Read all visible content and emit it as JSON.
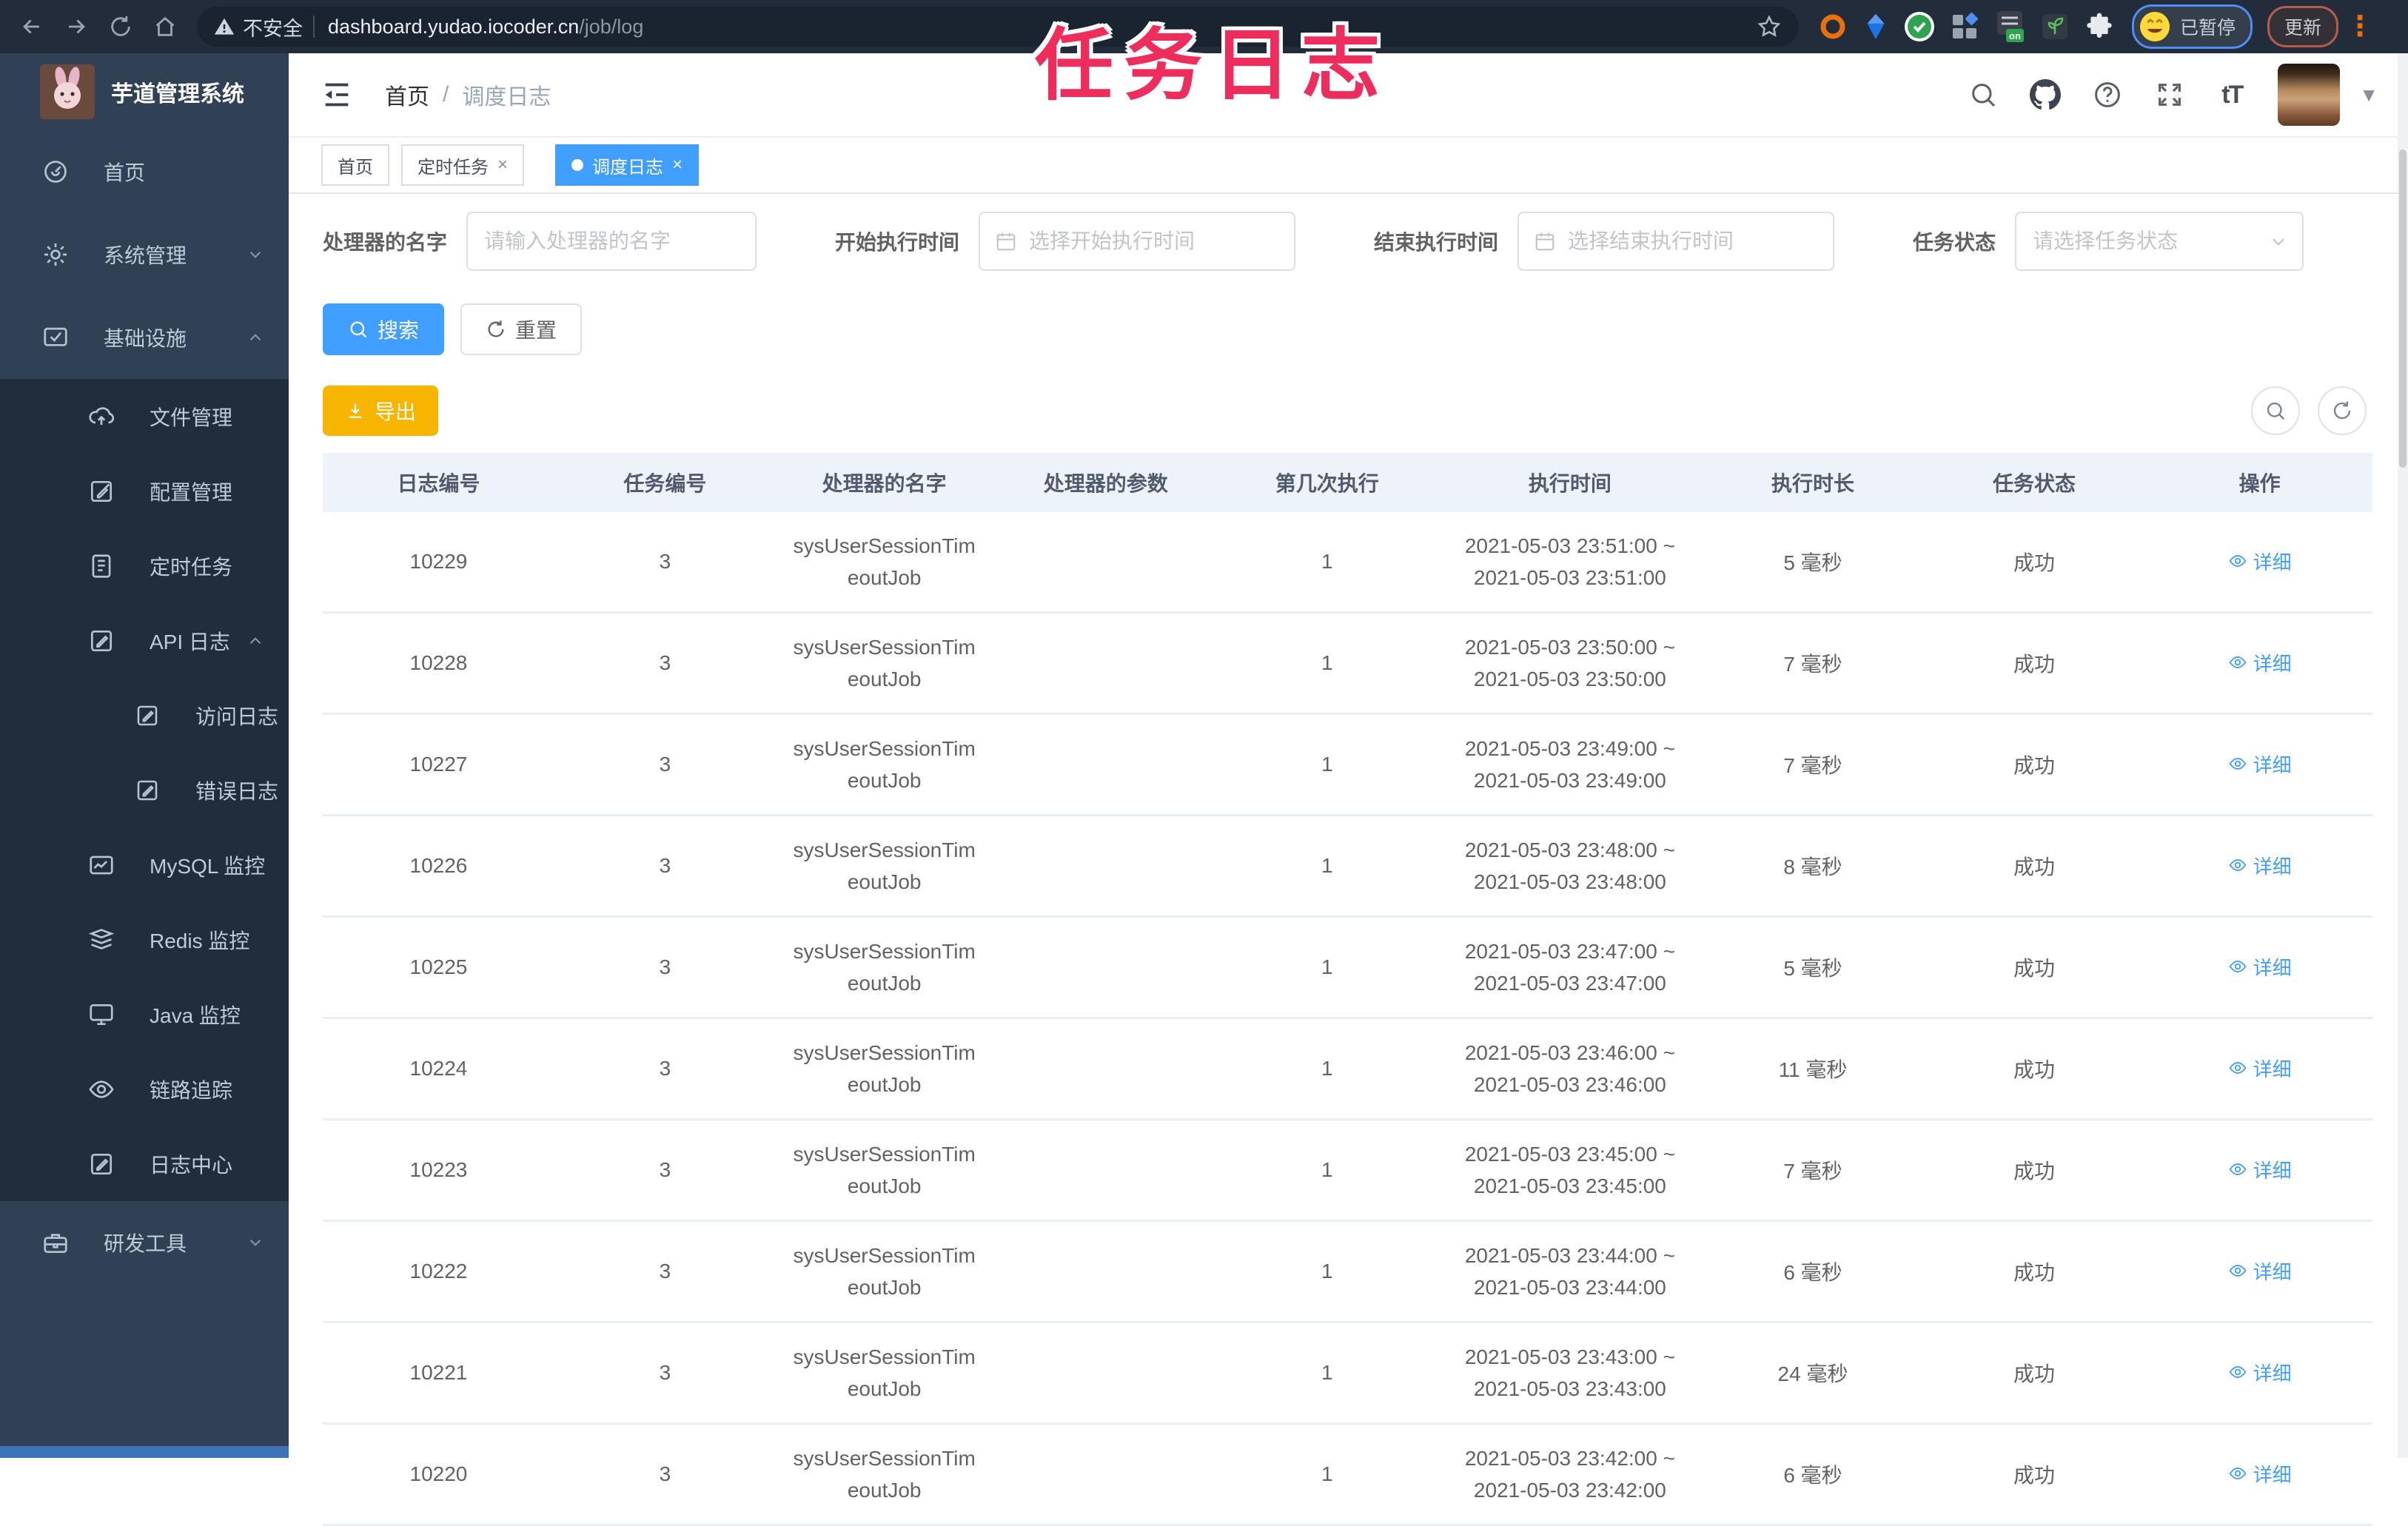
{
  "overlay_title": "任务日志",
  "browser": {
    "security": "不安全",
    "url_host": "dashboard.yudao.iocoder.cn",
    "url_path": "/job/log",
    "profile_status": "已暂停",
    "update_label": "更新",
    "menu_dots": "⋮"
  },
  "sidebar": {
    "app_title": "芋道管理系统",
    "items": [
      {
        "label": "首页"
      },
      {
        "label": "系统管理"
      },
      {
        "label": "基础设施"
      },
      {
        "label": "文件管理"
      },
      {
        "label": "配置管理"
      },
      {
        "label": "定时任务"
      },
      {
        "label": "API 日志"
      },
      {
        "label": "访问日志"
      },
      {
        "label": "错误日志"
      },
      {
        "label": "MySQL 监控"
      },
      {
        "label": "Redis 监控"
      },
      {
        "label": "Java 监控"
      },
      {
        "label": "链路追踪"
      },
      {
        "label": "日志中心"
      },
      {
        "label": "研发工具"
      }
    ]
  },
  "header": {
    "breadcrumb_home": "首页",
    "breadcrumb_separator": "/",
    "breadcrumb_current": "调度日志",
    "font_size_icon_label": "tT"
  },
  "tabs": {
    "close_icon": "×",
    "items": [
      {
        "label": "首页"
      },
      {
        "label": "定时任务"
      },
      {
        "label": "调度日志"
      }
    ]
  },
  "filters": {
    "handler_label": "处理器的名字",
    "handler_placeholder": "请输入处理器的名字",
    "start_label": "开始执行时间",
    "start_placeholder": "选择开始执行时间",
    "end_label": "结束执行时间",
    "end_placeholder": "选择结束执行时间",
    "status_label": "任务状态",
    "status_placeholder": "请选择任务状态"
  },
  "buttons": {
    "search": "搜索",
    "reset": "重置",
    "export": "导出"
  },
  "table": {
    "columns": [
      "日志编号",
      "任务编号",
      "处理器的名字",
      "处理器的参数",
      "第几次执行",
      "执行时间",
      "执行时长",
      "任务状态",
      "操作"
    ],
    "detail_label": "详细",
    "rows": [
      {
        "id": "10229",
        "job": "3",
        "handler1": "sysUserSessionTim",
        "handler2": "eoutJob",
        "param": "",
        "count": "1",
        "time1": "2021-05-03 23:51:00 ~",
        "time2": "2021-05-03 23:51:00",
        "duration": "5 毫秒",
        "status": "成功"
      },
      {
        "id": "10228",
        "job": "3",
        "handler1": "sysUserSessionTim",
        "handler2": "eoutJob",
        "param": "",
        "count": "1",
        "time1": "2021-05-03 23:50:00 ~",
        "time2": "2021-05-03 23:50:00",
        "duration": "7 毫秒",
        "status": "成功"
      },
      {
        "id": "10227",
        "job": "3",
        "handler1": "sysUserSessionTim",
        "handler2": "eoutJob",
        "param": "",
        "count": "1",
        "time1": "2021-05-03 23:49:00 ~",
        "time2": "2021-05-03 23:49:00",
        "duration": "7 毫秒",
        "status": "成功"
      },
      {
        "id": "10226",
        "job": "3",
        "handler1": "sysUserSessionTim",
        "handler2": "eoutJob",
        "param": "",
        "count": "1",
        "time1": "2021-05-03 23:48:00 ~",
        "time2": "2021-05-03 23:48:00",
        "duration": "8 毫秒",
        "status": "成功"
      },
      {
        "id": "10225",
        "job": "3",
        "handler1": "sysUserSessionTim",
        "handler2": "eoutJob",
        "param": "",
        "count": "1",
        "time1": "2021-05-03 23:47:00 ~",
        "time2": "2021-05-03 23:47:00",
        "duration": "5 毫秒",
        "status": "成功"
      },
      {
        "id": "10224",
        "job": "3",
        "handler1": "sysUserSessionTim",
        "handler2": "eoutJob",
        "param": "",
        "count": "1",
        "time1": "2021-05-03 23:46:00 ~",
        "time2": "2021-05-03 23:46:00",
        "duration": "11 毫秒",
        "status": "成功"
      },
      {
        "id": "10223",
        "job": "3",
        "handler1": "sysUserSessionTim",
        "handler2": "eoutJob",
        "param": "",
        "count": "1",
        "time1": "2021-05-03 23:45:00 ~",
        "time2": "2021-05-03 23:45:00",
        "duration": "7 毫秒",
        "status": "成功"
      },
      {
        "id": "10222",
        "job": "3",
        "handler1": "sysUserSessionTim",
        "handler2": "eoutJob",
        "param": "",
        "count": "1",
        "time1": "2021-05-03 23:44:00 ~",
        "time2": "2021-05-03 23:44:00",
        "duration": "6 毫秒",
        "status": "成功"
      },
      {
        "id": "10221",
        "job": "3",
        "handler1": "sysUserSessionTim",
        "handler2": "eoutJob",
        "param": "",
        "count": "1",
        "time1": "2021-05-03 23:43:00 ~",
        "time2": "2021-05-03 23:43:00",
        "duration": "24 毫秒",
        "status": "成功"
      },
      {
        "id": "10220",
        "job": "3",
        "handler1": "sysUserSessionTim",
        "handler2": "eoutJob",
        "param": "",
        "count": "1",
        "time1": "2021-05-03 23:42:00 ~",
        "time2": "2021-05-03 23:42:00",
        "duration": "6 毫秒",
        "status": "成功"
      }
    ]
  },
  "colors": {
    "primary": "#409eff",
    "warning": "#f7b500",
    "overlay": "#ee2d5d",
    "sidebar_bg": "#304156",
    "sidebar_submenu_bg": "#1f2d3d",
    "chrome_bg": "#222c3a"
  }
}
